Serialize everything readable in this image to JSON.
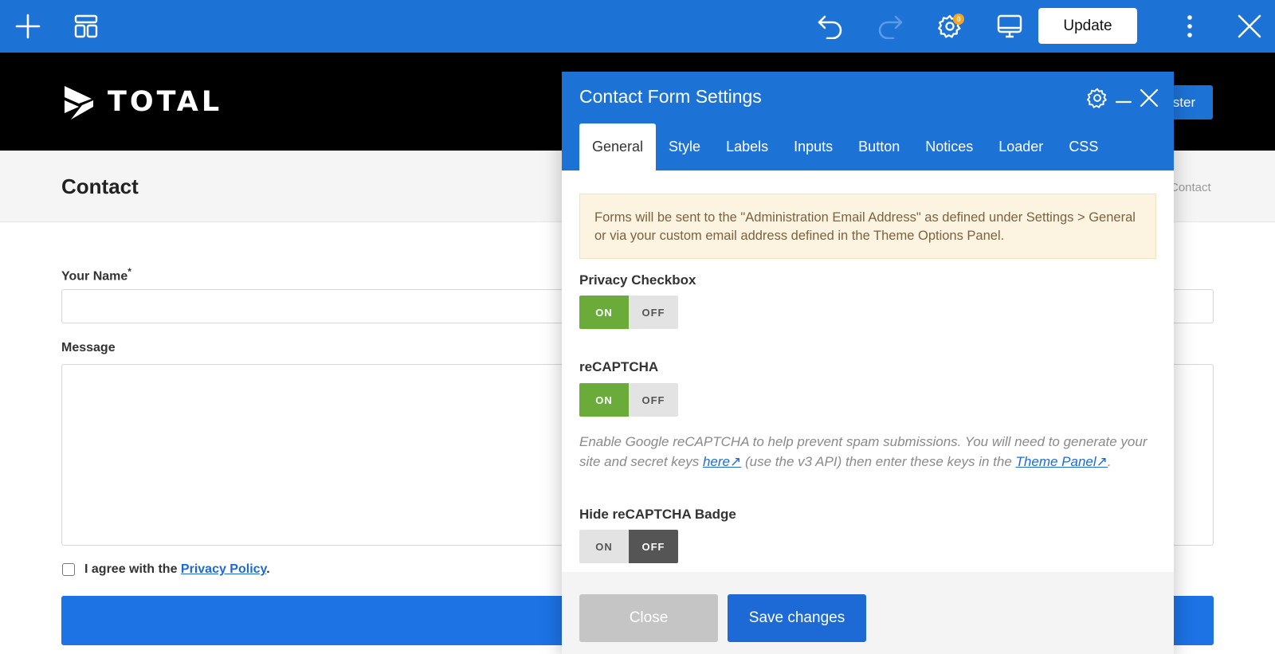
{
  "toolbar": {
    "icons": [
      "add-icon",
      "layout-icon",
      "undo-icon",
      "redo-icon",
      "settings-icon",
      "desktop-preview-icon",
      "more-vertical-icon",
      "close-icon"
    ],
    "settings_badge": "0",
    "update_label": "Update",
    "colors": {
      "bar": "#1d72d6",
      "badge": "#f5a623"
    }
  },
  "site": {
    "logo_text": "TOTAL",
    "register_label": "ister"
  },
  "page": {
    "title": "Contact",
    "breadcrumb_current": "Contact"
  },
  "form": {
    "name_label": "Your Name",
    "name_required": "*",
    "message_label": "Message",
    "agree_prefix": "I agree with the",
    "agree_link": "Privacy Policy",
    "agree_suffix": "."
  },
  "modal": {
    "title": "Contact Form Settings",
    "tabs": [
      "General",
      "Style",
      "Labels",
      "Inputs",
      "Button",
      "Notices",
      "Loader",
      "CSS"
    ],
    "active_tab": "General",
    "notice": "Forms will be sent to the \"Administration Email Address\" as defined under Settings > General or via your custom email address defined in the Theme Options Panel.",
    "options": [
      {
        "label": "Privacy Checkbox",
        "on": "ON",
        "off": "OFF",
        "value": "ON"
      },
      {
        "label": "reCAPTCHA",
        "on": "ON",
        "off": "OFF",
        "value": "ON"
      },
      {
        "label": "Hide reCAPTCHA Badge",
        "on": "ON",
        "off": "OFF",
        "value": "OFF"
      }
    ],
    "recaptcha_help": {
      "part1": "Enable Google reCAPTCHA to help prevent spam submissions. You will need to generate your site and secret keys ",
      "link1": "here↗",
      "part2": " (use the v3 API) then enter these keys in the ",
      "link2": "Theme Panel↗",
      "part3": "."
    },
    "close_label": "Close",
    "save_label": "Save changes",
    "colors": {
      "on": "#6aab3a",
      "off_active": "#555555",
      "primary": "#1d72d6"
    }
  }
}
